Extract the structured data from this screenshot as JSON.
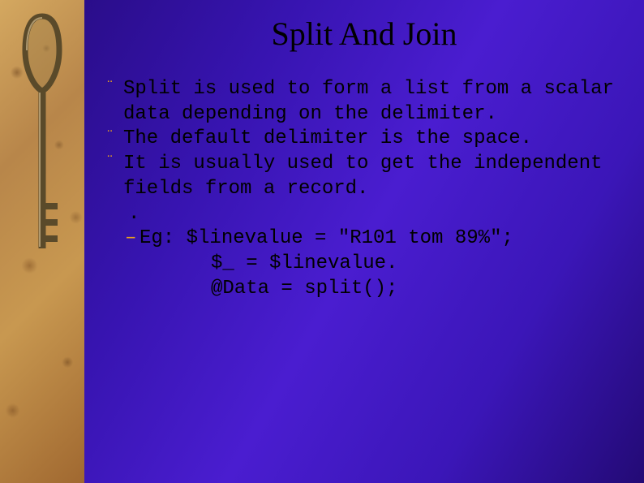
{
  "title": "Split And Join",
  "bullets": [
    "Split is used to form a list from a scalar data depending on the delimiter.",
    " The default delimiter is the space.",
    " It is usually used to get the independent fields from a record."
  ],
  "sub_dot": ".",
  "example_label": "Eg: ",
  "code_lines": [
    "$linevalue = \"R101 tom 89%\";",
    "$_ = $linevalue.",
    "@Data = split();"
  ],
  "bullet_glyph": "¨",
  "dash_glyph": "–",
  "icon_name": "key-icon"
}
